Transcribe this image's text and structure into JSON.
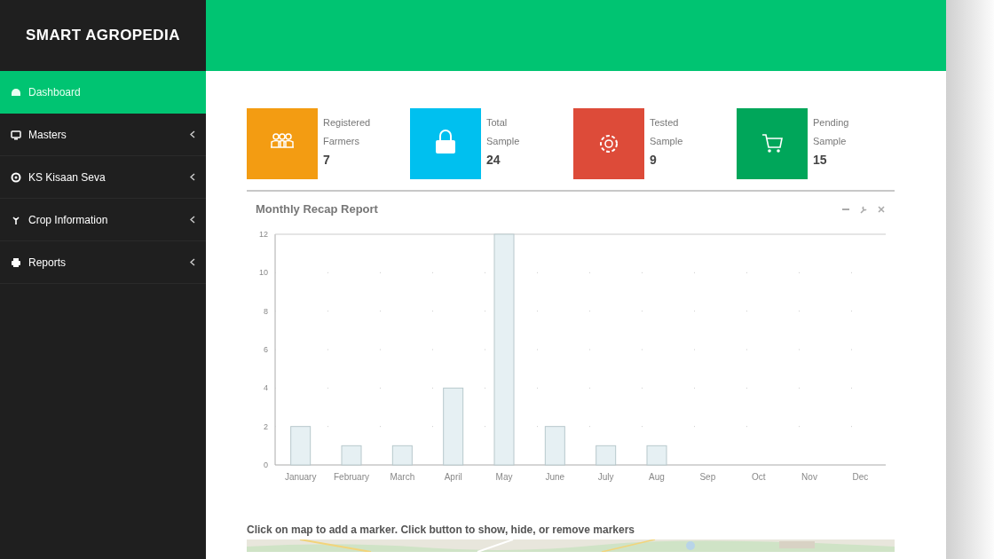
{
  "brand": "SMART AGROPEDIA",
  "sidebar": {
    "items": [
      {
        "label": "Dashboard",
        "selected": true,
        "has_submenu": false
      },
      {
        "label": "Masters",
        "selected": false,
        "has_submenu": true
      },
      {
        "label": "KS Kisaan Seva",
        "selected": false,
        "has_submenu": true
      },
      {
        "label": "Crop Information",
        "selected": false,
        "has_submenu": true
      },
      {
        "label": "Reports",
        "selected": false,
        "has_submenu": true
      }
    ]
  },
  "stats": [
    {
      "label": "Registered Farmers",
      "value": "7",
      "color": "#f39c12"
    },
    {
      "label": "Total Sample",
      "value": "24",
      "color": "#00c0ef"
    },
    {
      "label": "Tested Sample",
      "value": "9",
      "color": "#dd4b39"
    },
    {
      "label": "Pending Sample",
      "value": "15",
      "color": "#00a65a"
    }
  ],
  "report": {
    "title": "Monthly Recap Report",
    "chart_data": {
      "type": "bar",
      "categories": [
        "January",
        "February",
        "March",
        "April",
        "May",
        "June",
        "July",
        "Aug",
        "Sep",
        "Oct",
        "Nov",
        "Dec"
      ],
      "values": [
        2,
        1,
        1,
        4,
        12,
        2,
        1,
        1,
        0,
        0,
        0,
        0
      ],
      "ylim": [
        0,
        12
      ],
      "yticks": [
        0,
        2,
        4,
        6,
        8,
        10,
        12
      ],
      "grid": true
    }
  },
  "map": {
    "instructions": "Click on map to add a marker. Click button to show, hide, or remove markers",
    "kind": "picture"
  }
}
